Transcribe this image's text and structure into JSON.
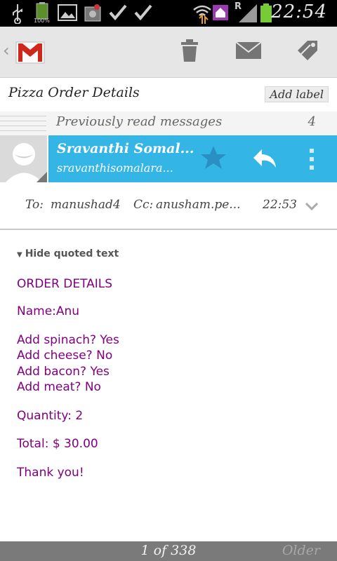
{
  "status_bar": {
    "battery_label": "100%",
    "network_label": "R",
    "clock": "22:54"
  },
  "action_bar": {
    "icons": [
      "gmail-logo",
      "trash-icon",
      "mark-unread-icon",
      "label-icon"
    ]
  },
  "subject": "Pizza Order Details",
  "add_label": "Add label",
  "previous": {
    "text": "Previously read messages",
    "count": "4"
  },
  "sender": {
    "name": "Sravanthi Somal...",
    "email": "sravanthisomalara..."
  },
  "recipients": {
    "to_label": "To:",
    "to_value": "manushad4",
    "cc_label": "Cc:",
    "cc_value": "anusham.pe...",
    "time": "22:53"
  },
  "hide_quoted": "Hide quoted text",
  "body": {
    "title": "ORDER DETAILS",
    "name": "Name:Anu",
    "spinach": "Add spinach? Yes",
    "cheese": "Add cheese? No",
    "bacon": "Add bacon? Yes",
    "meat": "Add meat? No",
    "quantity": "Quantity: 2",
    "total": "Total: $ 30.00",
    "thanks": "Thank you!"
  },
  "footer": {
    "pager": "1 of 338",
    "older": "Older"
  },
  "colors": {
    "accent_blue": "#33b5e5",
    "body_text": "#800080"
  }
}
